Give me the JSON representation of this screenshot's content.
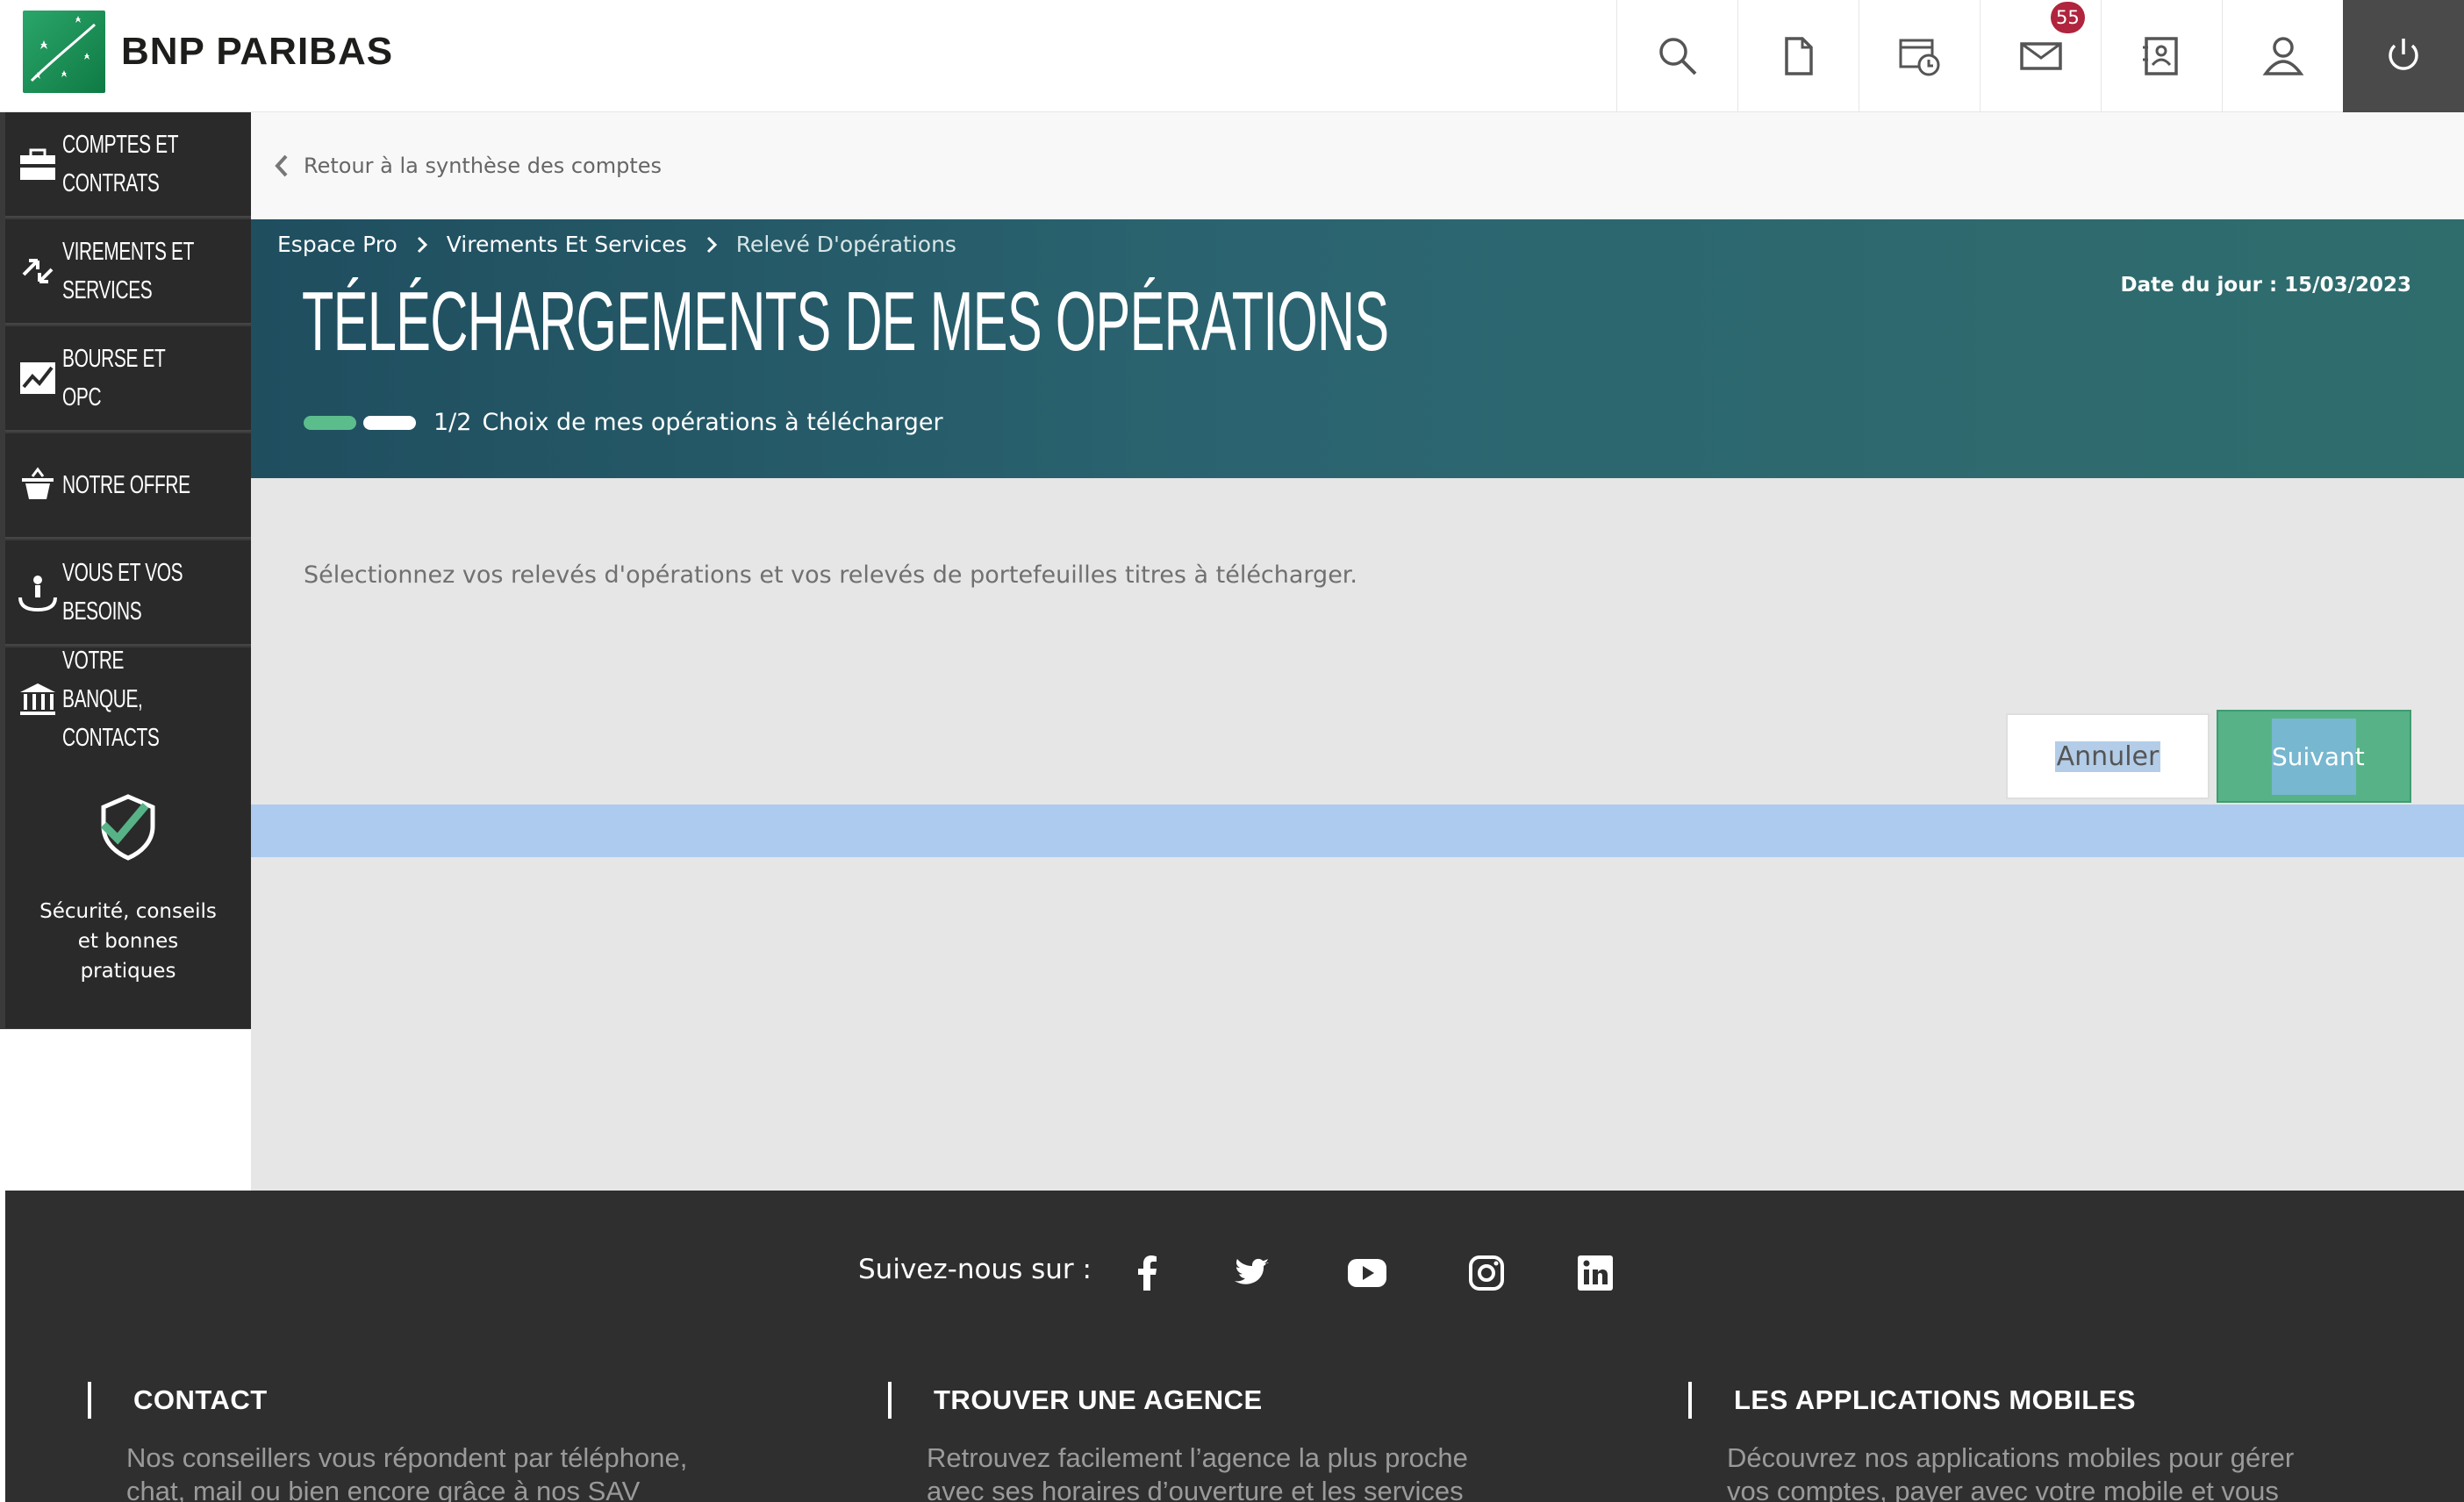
{
  "brand": {
    "name": "BNP PARIBAS",
    "accent": "#2aa66a"
  },
  "header": {
    "icons": [
      {
        "name": "search-icon"
      },
      {
        "name": "document-icon"
      },
      {
        "name": "history-icon"
      },
      {
        "name": "mail-icon",
        "badge": "55"
      },
      {
        "name": "contacts-icon"
      },
      {
        "name": "profile-icon"
      },
      {
        "name": "power-icon"
      }
    ]
  },
  "sidebar": {
    "items": [
      {
        "label": "Comptes et contrats",
        "icon": "briefcase-icon"
      },
      {
        "label": "Virements et services",
        "icon": "transfer-arrows-icon"
      },
      {
        "label": "Bourse et OPC",
        "icon": "stock-chart-icon"
      },
      {
        "label": "Notre offre",
        "icon": "basket-icon"
      },
      {
        "label": "Vous et vos besoins",
        "icon": "hand-person-icon"
      },
      {
        "label": "Votre banque, contacts",
        "icon": "bank-icon"
      }
    ],
    "security_label": "Sécurité, conseils et bonnes pratiques"
  },
  "back_link": "Retour à la synthèse des comptes",
  "breadcrumb": {
    "items": [
      "Espace Pro",
      "Virements Et Services",
      "Relevé D'opérations"
    ]
  },
  "hero": {
    "title": "TÉLÉCHARGEMENTS DE MES OPÉRATIONS",
    "date": "Date du jour : 15/03/2023",
    "step": "1/2",
    "step_label": "Choix de mes opérations à télécharger",
    "progress": {
      "current": 1,
      "total": 2
    }
  },
  "content": {
    "intro": "Sélectionnez vos relevés d'opérations et vos relevés de portefeuilles titres à télécharger.",
    "cancel_label": "Annuler",
    "next_label": "Suivant"
  },
  "footer": {
    "follow_label": "Suivez-nous sur :",
    "socials": [
      "facebook-icon",
      "twitter-icon",
      "youtube-icon",
      "instagram-icon",
      "linkedin-icon"
    ],
    "columns": [
      {
        "title": "CONTACT",
        "line1": "Nos conseillers vous répondent par téléphone,",
        "line2": "chat, mail ou bien encore grâce à nos SAV"
      },
      {
        "title": "TROUVER UNE AGENCE",
        "line1": "Retrouvez facilement l’agence la plus proche",
        "line2": "avec ses horaires d’ouverture et les services"
      },
      {
        "title": "LES APPLICATIONS MOBILES",
        "line1": "Découvrez nos applications mobiles pour gérer",
        "line2": "vos comptes, payer avec votre mobile et vous"
      }
    ]
  }
}
